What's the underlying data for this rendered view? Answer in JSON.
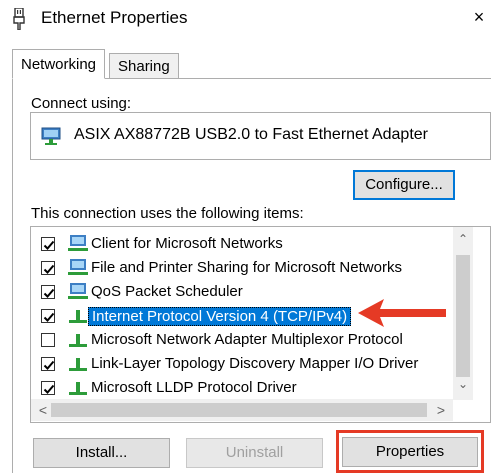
{
  "window": {
    "title": "Ethernet Properties",
    "close_glyph": "×"
  },
  "tabs": [
    {
      "label": "Networking",
      "active": true
    },
    {
      "label": "Sharing",
      "active": false
    }
  ],
  "connect_using": {
    "label": "Connect using:",
    "adapter": "ASIX AX88772B USB2.0 to Fast Ethernet Adapter",
    "adapter_icon": "network-adapter-icon"
  },
  "configure_button": "Configure...",
  "items_label": "This connection uses the following items:",
  "items": [
    {
      "label": "Client for Microsoft Networks",
      "checked": true,
      "icon": "client-network-icon",
      "selected": false
    },
    {
      "label": "File and Printer Sharing for Microsoft Networks",
      "checked": true,
      "icon": "client-network-icon",
      "selected": false
    },
    {
      "label": "QoS Packet Scheduler",
      "checked": true,
      "icon": "client-network-icon",
      "selected": false
    },
    {
      "label": "Internet Protocol Version 4 (TCP/IPv4)",
      "checked": true,
      "icon": "protocol-icon",
      "selected": true
    },
    {
      "label": "Microsoft Network Adapter Multiplexor Protocol",
      "checked": false,
      "icon": "protocol-icon",
      "selected": false
    },
    {
      "label": "Link-Layer Topology Discovery Mapper I/O Driver",
      "checked": true,
      "icon": "protocol-icon",
      "selected": false
    },
    {
      "label": "Microsoft LLDP Protocol Driver",
      "checked": true,
      "icon": "protocol-icon",
      "selected": false
    }
  ],
  "scroll_glyphs": {
    "up": "⌃",
    "down": "⌄",
    "left": "<",
    "right": ">"
  },
  "buttons": {
    "install": "Install...",
    "uninstall": "Uninstall",
    "properties": "Properties"
  },
  "colors": {
    "selection": "#0078d7",
    "highlight_red": "#e53a25",
    "focus_border": "#0078d7"
  }
}
